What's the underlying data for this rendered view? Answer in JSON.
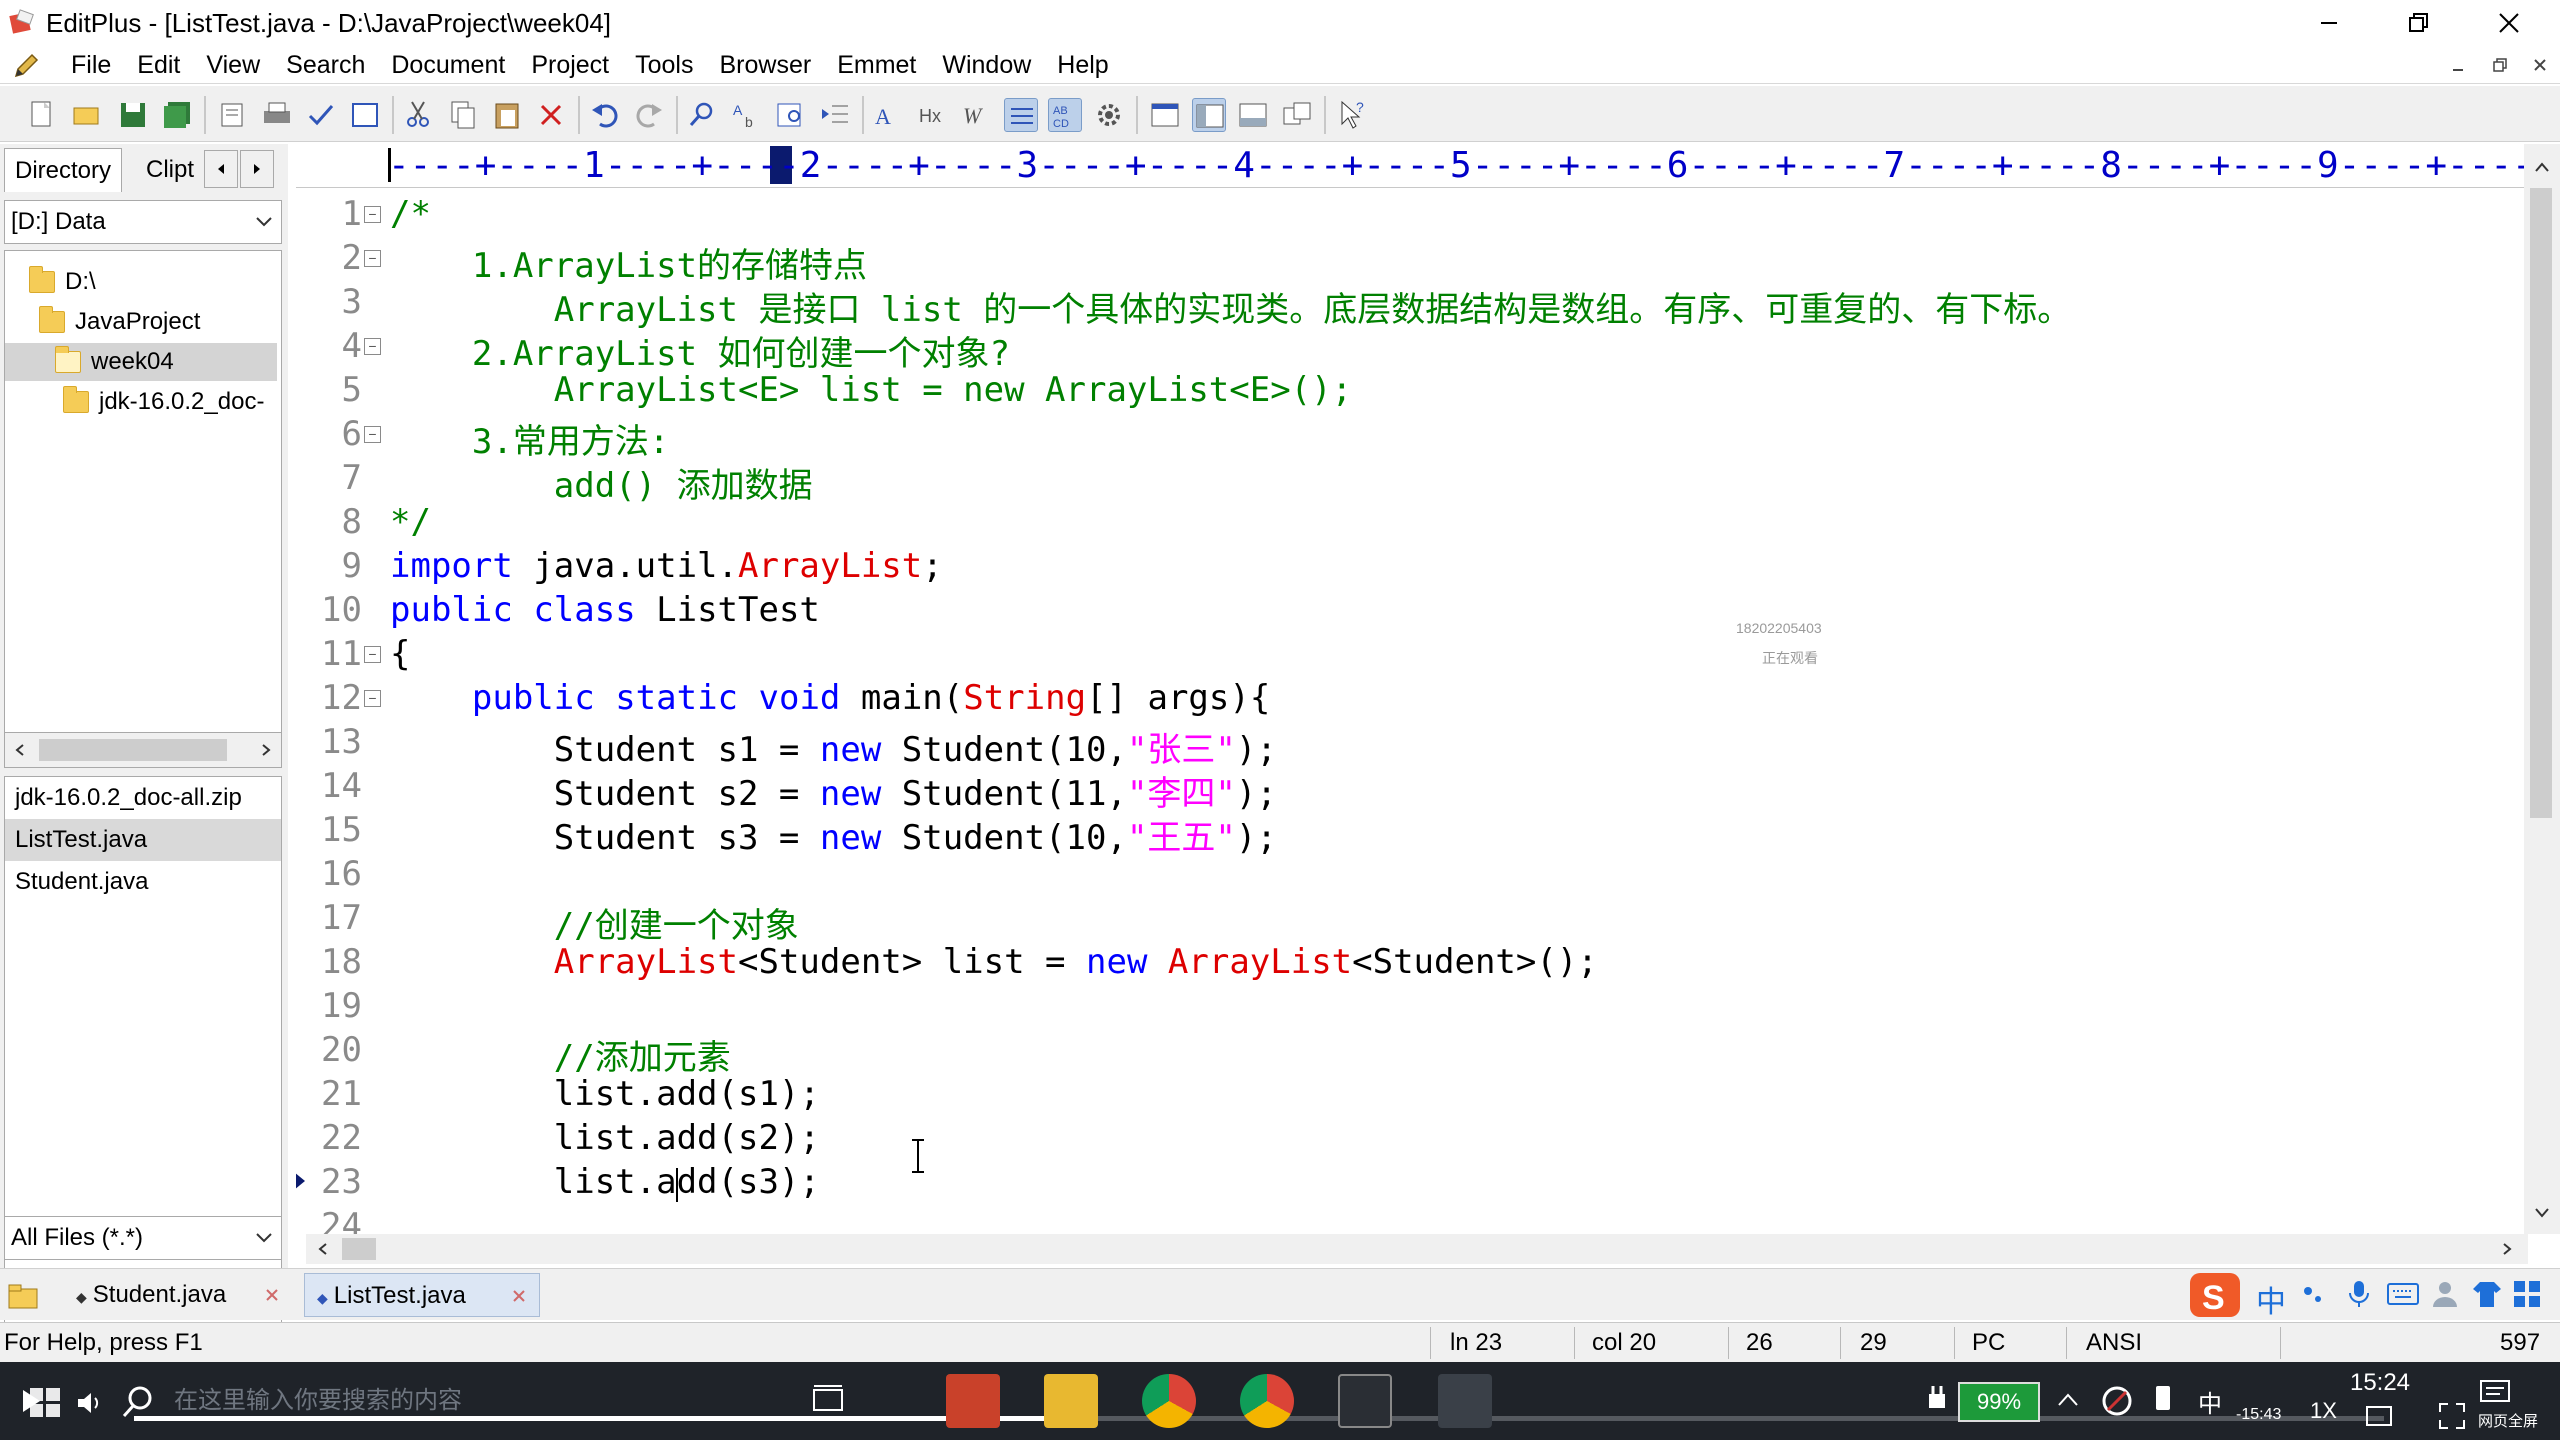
{
  "window": {
    "title": "EditPlus - [ListTest.java - D:\\JavaProject\\week04]"
  },
  "menu": [
    "File",
    "Edit",
    "View",
    "Search",
    "Document",
    "Project",
    "Tools",
    "Browser",
    "Emmet",
    "Window",
    "Help"
  ],
  "left_panel": {
    "tabs": [
      "Directory",
      "Clipt"
    ],
    "drive": "[D:] Data",
    "tree": [
      "D:\\",
      "JavaProject",
      "week04",
      "jdk-16.0.2_doc-"
    ],
    "files": [
      "jdk-16.0.2_doc-all.zip",
      "ListTest.java",
      "Student.java"
    ],
    "filter": "All Files (*.*)"
  },
  "ruler": "----+----1----+----2----+----3----+----4----+----5----+----6----+----7----+----8----+----9----+----0----+-",
  "code": {
    "lines": [
      {
        "n": "1",
        "t": "/*"
      },
      {
        "n": "2",
        "t": "    1.ArrayList的存储特点"
      },
      {
        "n": "3",
        "t": "        ArrayList 是接口 list 的一个具体的实现类。底层数据结构是数组。有序、可重复的、有下标。"
      },
      {
        "n": "4",
        "t": "    2.ArrayList 如何创建一个对象?"
      },
      {
        "n": "5",
        "t": "        ArrayList<E> list = new ArrayList<E>();"
      },
      {
        "n": "6",
        "t": "    3.常用方法:"
      },
      {
        "n": "7",
        "t": "        add() 添加数据"
      },
      {
        "n": "8",
        "t": "*/"
      },
      {
        "n": "9",
        "t": "import java.util.ArrayList;"
      },
      {
        "n": "10",
        "t": "public class ListTest"
      },
      {
        "n": "11",
        "t": "{"
      },
      {
        "n": "12",
        "t": "    public static void main(String[] args){"
      },
      {
        "n": "13",
        "t": "        Student s1 = new Student(10,\"张三\");"
      },
      {
        "n": "14",
        "t": "        Student s2 = new Student(11,\"李四\");"
      },
      {
        "n": "15",
        "t": "        Student s3 = new Student(10,\"王五\");"
      },
      {
        "n": "16",
        "t": ""
      },
      {
        "n": "17",
        "t": "        //创建一个对象"
      },
      {
        "n": "18",
        "t": "        ArrayList<Student> list = new ArrayList<Student>();"
      },
      {
        "n": "19",
        "t": ""
      },
      {
        "n": "20",
        "t": "        //添加元素"
      },
      {
        "n": "21",
        "t": "        list.add(s1);"
      },
      {
        "n": "22",
        "t": "        list.add(s2);"
      },
      {
        "n": "23",
        "t": "        list.add(s3);"
      },
      {
        "n": "24",
        "t": ""
      }
    ],
    "fold_lines": [
      "1",
      "2",
      "4",
      "6",
      "11",
      "12"
    ],
    "current_line": "23"
  },
  "watermark": {
    "id": "18202205403",
    "status": "正在观看"
  },
  "doc_tabs": [
    "Student.java",
    "ListTest.java"
  ],
  "active_doc_tab": "ListTest.java",
  "status": {
    "help": "For Help, press F1",
    "ln": "ln 23",
    "col": "col 20",
    "f1": "26",
    "f2": "29",
    "mode": "PC",
    "enc": "ANSI",
    "num": "597"
  },
  "taskbar": {
    "search_placeholder": "在这里输入你要搜索的内容",
    "time": "15:24",
    "battery": "99%",
    "ime": "中",
    "playback": "1X",
    "elapsed": "-15:43",
    "fullscreen": "网页全屏"
  },
  "colors": {
    "comment": "#008000",
    "keyword": "#0000ff",
    "class": "#dd0000",
    "string": "#ff00ff",
    "line_number": "#8a8a8a",
    "ruler": "#0000c8"
  }
}
